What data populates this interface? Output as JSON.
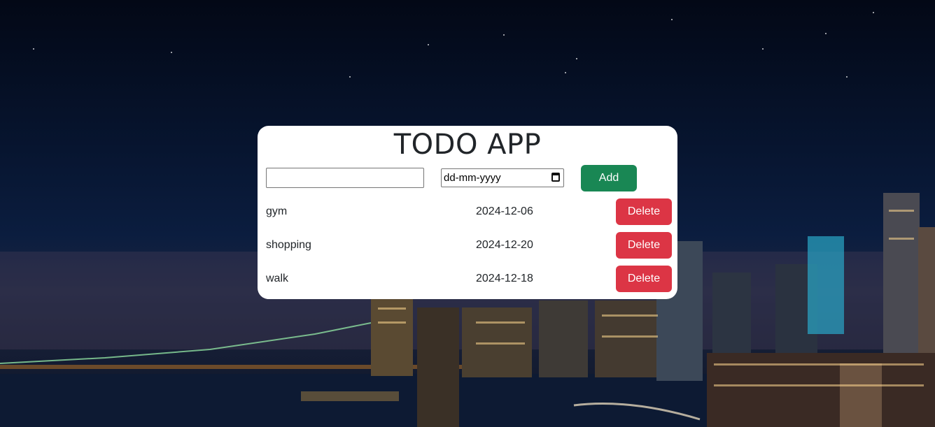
{
  "app": {
    "title": "TODO APP"
  },
  "form": {
    "task_value": "",
    "date_placeholder": "dd-mm-yyyy",
    "add_label": "Add"
  },
  "todos": [
    {
      "name": "gym",
      "date": "2024-12-06",
      "delete_label": "Delete"
    },
    {
      "name": "shopping",
      "date": "2024-12-20",
      "delete_label": "Delete"
    },
    {
      "name": "walk",
      "date": "2024-12-18",
      "delete_label": "Delete"
    }
  ],
  "colors": {
    "add_button": "#198754",
    "delete_button": "#dc3545",
    "card": "#ffffff"
  },
  "icons": {
    "date_picker": "calendar-icon"
  }
}
